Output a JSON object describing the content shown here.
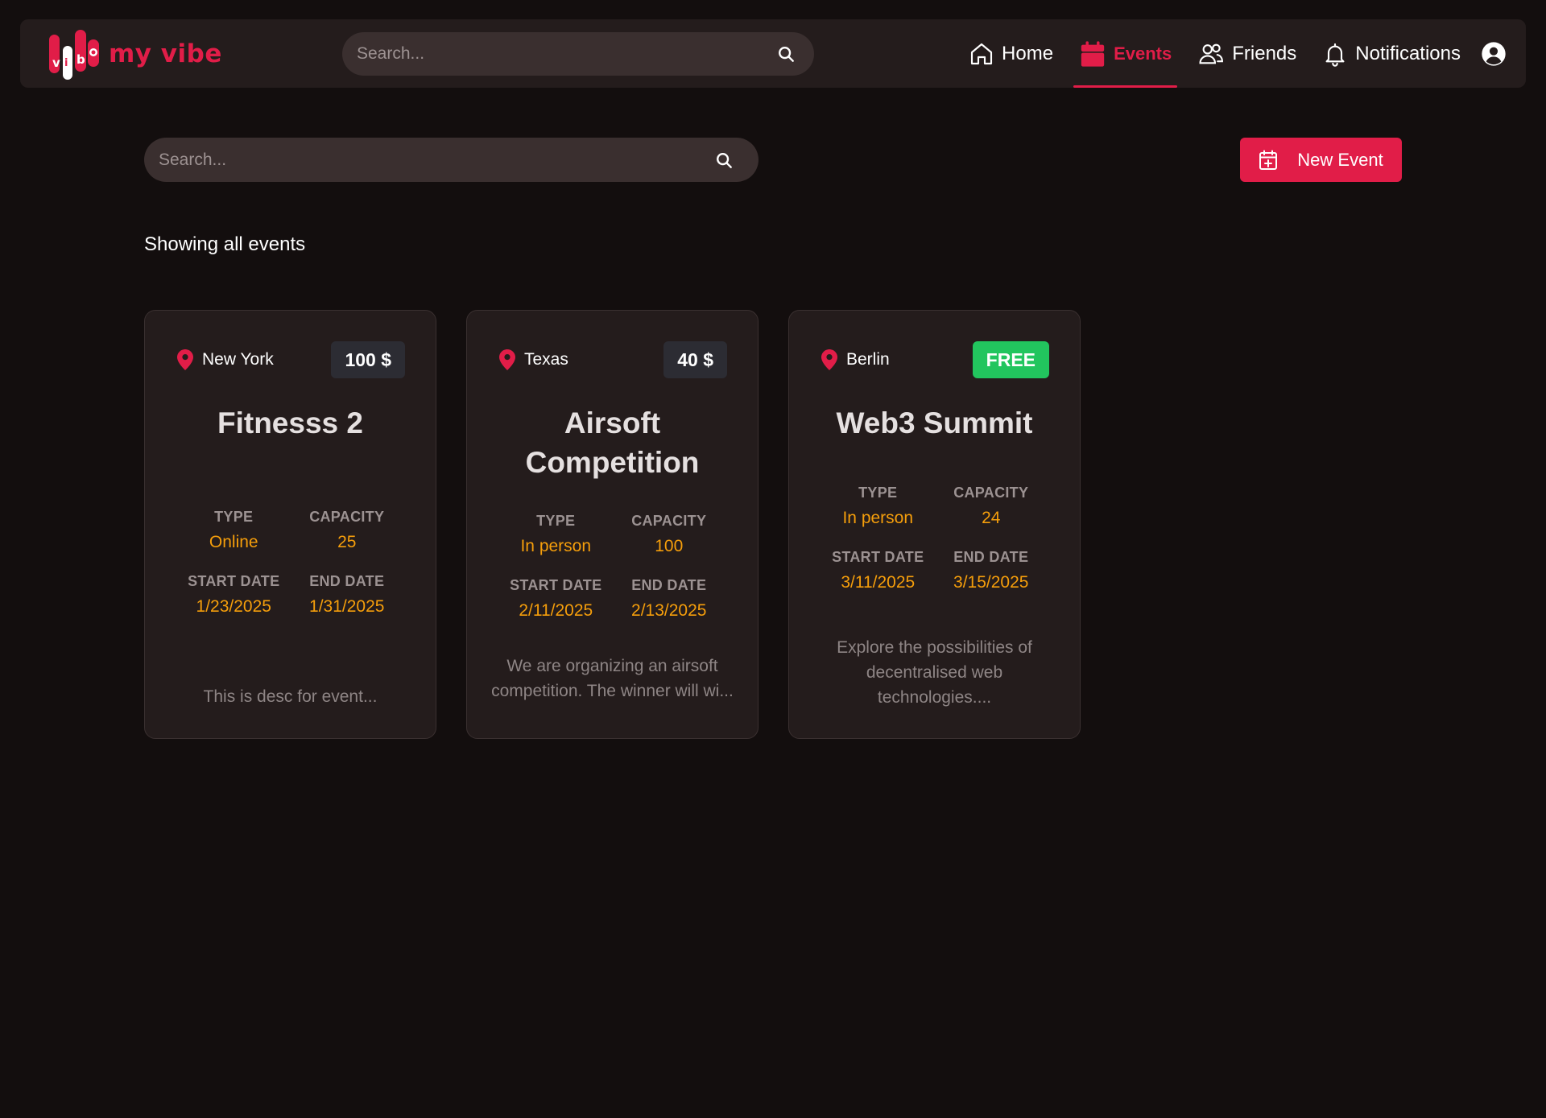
{
  "app": {
    "name": "my vibe"
  },
  "header": {
    "search_placeholder": "Search...",
    "nav": [
      {
        "label": "Home",
        "icon": "home-icon",
        "active": false
      },
      {
        "label": "Events",
        "icon": "calendar-icon",
        "active": true
      },
      {
        "label": "Friends",
        "icon": "friends-icon",
        "active": false
      },
      {
        "label": "Notifications",
        "icon": "bell-icon",
        "active": false
      }
    ],
    "profile_icon": "user-circle-icon"
  },
  "toolbar": {
    "search_placeholder": "Search...",
    "new_event_label": "New Event"
  },
  "status_text": "Showing all events",
  "labels": {
    "type": "TYPE",
    "capacity": "CAPACITY",
    "start_date": "START DATE",
    "end_date": "END DATE"
  },
  "events": [
    {
      "location": "New York",
      "price": "100 $",
      "title": "Fitnesss 2",
      "type": "Online",
      "capacity": "25",
      "start_date": "1/23/2025",
      "end_date": "1/31/2025",
      "description": "This is desc for event..."
    },
    {
      "location": "Texas",
      "price": "40 $",
      "title": "Airsoft Competition",
      "type": "In person",
      "capacity": "100",
      "start_date": "2/11/2025",
      "end_date": "2/13/2025",
      "description": "We are organizing an airsoft competition. The winner will wi..."
    },
    {
      "location": "Berlin",
      "price": "FREE",
      "title": "Web3 Summit",
      "type": "In person",
      "capacity": "24",
      "start_date": "3/11/2025",
      "end_date": "3/15/2025",
      "description": "Explore the possibilities of decentralised web technologies...."
    }
  ],
  "colors": {
    "accent": "#e11d48",
    "value": "#f59e0b",
    "free_badge": "#22c55e",
    "background": "#130e0e",
    "card": "#241c1c"
  }
}
